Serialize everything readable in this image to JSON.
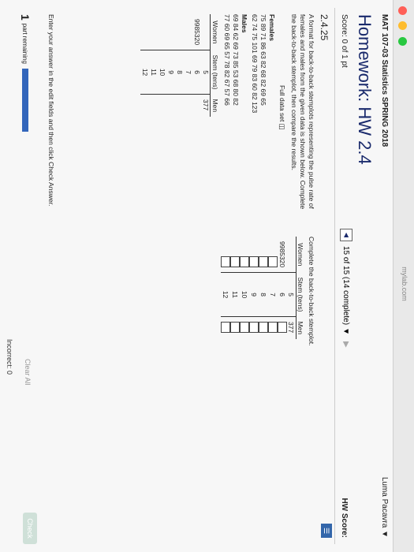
{
  "browser": {
    "url": "mylab.com"
  },
  "header": {
    "course": "MAT 107-03 Statistics SPRING 2018",
    "user": "Luma Pacavra",
    "title": "Homework: HW 2.4",
    "score": "Score: 0 of 1 pt",
    "hw_score": "HW Score:",
    "progress": "15 of 15 (14 complete)"
  },
  "problem": {
    "id": "2.4.25",
    "intro": "A format for back-to-back stemplots representing the pulse rate of females and males from the given data is shown below. Complete the back-to-back stemplot, then compare the results.",
    "full_data_label": "Full data set",
    "females_label": "Females",
    "females_row1": "75  89  71  86  63  82  68  82  69  65",
    "females_row2": "62  74  75  101  69  79  83  60  82  123",
    "males_label": "Males",
    "males_row1": "69  84  62  69  73  85  53  68  80  82",
    "males_row2": "77  60  69  65  57  78  82  67  57  66",
    "format": {
      "women_header": "Women",
      "stem_header": "Stem (tens)",
      "men_header": "Men",
      "rows": [
        {
          "women": "",
          "stem": "5",
          "men": "377"
        },
        {
          "women": "9985320",
          "stem": "6",
          "men": ""
        },
        {
          "women": "",
          "stem": "7",
          "men": ""
        },
        {
          "women": "",
          "stem": "8",
          "men": ""
        },
        {
          "women": "",
          "stem": "9",
          "men": ""
        },
        {
          "women": "",
          "stem": "10",
          "men": ""
        },
        {
          "women": "",
          "stem": "11",
          "men": ""
        },
        {
          "women": "",
          "stem": "12",
          "men": ""
        }
      ]
    },
    "answer_prompt": "Complete the back-to-back stemplot.",
    "answer": {
      "women_header": "Women",
      "stem_header": "Stem (tens)",
      "men_header": "Men",
      "rows": [
        {
          "women": "",
          "stem": "5",
          "men": "377"
        },
        {
          "women": "9985320",
          "stem": "6",
          "men": ""
        },
        {
          "women": "",
          "stem": "7",
          "men": ""
        },
        {
          "women": "",
          "stem": "8",
          "men": ""
        },
        {
          "women": "",
          "stem": "9",
          "men": ""
        },
        {
          "women": "",
          "stem": "10",
          "men": ""
        },
        {
          "women": "",
          "stem": "11",
          "men": ""
        },
        {
          "women": "",
          "stem": "12",
          "men": ""
        }
      ]
    }
  },
  "footer": {
    "instruction": "Enter your answer in the edit fields and then click Check Answer.",
    "part_number": "1",
    "part_label": "part remaining",
    "clear_all": "Clear All",
    "check_answer": "Check",
    "incorrect": "Incorrect: 0"
  },
  "colors": {
    "title": "#1a2a6c",
    "accent": "#3366bb"
  }
}
